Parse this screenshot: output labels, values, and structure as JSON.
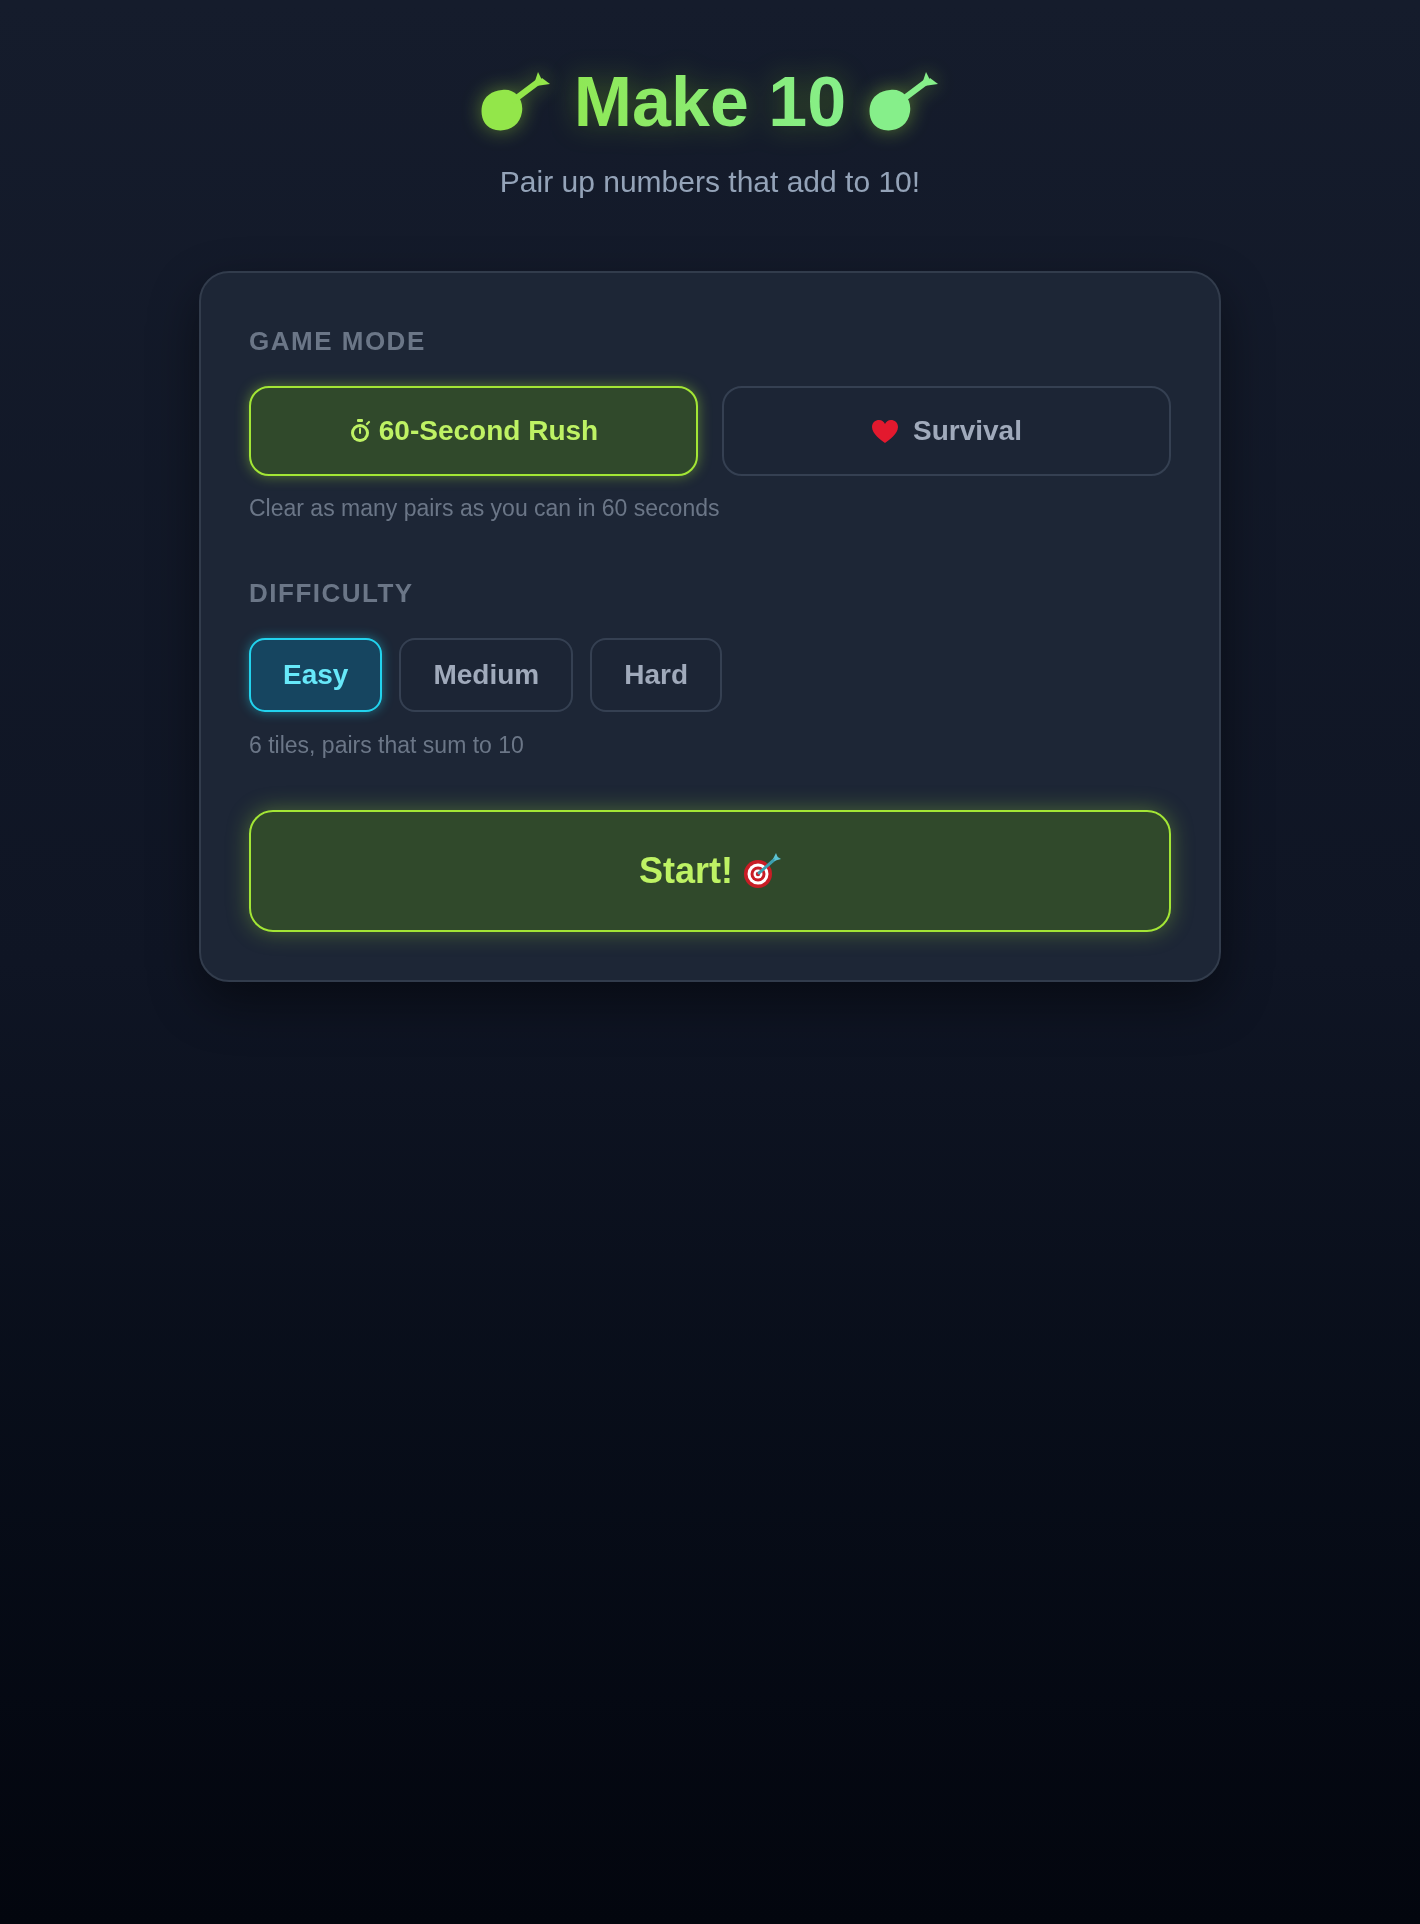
{
  "header": {
    "title": "Make 10",
    "subtitle": "Pair up numbers that add to 10!"
  },
  "game_mode": {
    "label": "GAME MODE",
    "options": [
      {
        "label": "60-Second Rush",
        "kind": "timed",
        "selected": true
      },
      {
        "label": "Survival",
        "kind": "lives",
        "selected": false
      }
    ],
    "description": "Clear as many pairs as you can in 60 seconds"
  },
  "difficulty": {
    "label": "DIFFICULTY",
    "options": [
      {
        "label": "Easy",
        "selected": true
      },
      {
        "label": "Medium",
        "selected": false
      },
      {
        "label": "Hard",
        "selected": false
      }
    ],
    "description": "6 tiles, pairs that sum to 10"
  },
  "start_button": {
    "label": "Start!"
  }
}
